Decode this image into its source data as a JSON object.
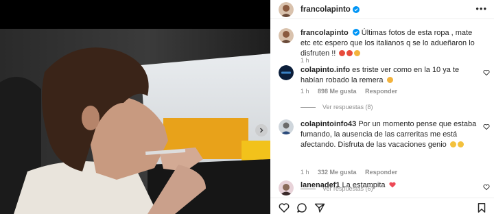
{
  "post": {
    "username": "francolapinto",
    "caption_user": "francolapinto",
    "caption_text": "Últimas fotos de esta ropa , mate etc etc espero que los italianos q se lo adueñaron lo disfruten !!",
    "caption_time": "1 h"
  },
  "comments": [
    {
      "user": "colapinto.info",
      "text": "es triste ver como en la 10 ya te habían robado la remera",
      "time": "1 h",
      "likes": "898 Me gusta",
      "reply": "Responder",
      "view_replies": "Ver respuestas (8)"
    },
    {
      "user": "colapintoinfo43",
      "text": "Por un momento pense que estaba fumando, la ausencia de las carreritas me está afectando. Disfruta de las vacaciones genio",
      "time": "1 h",
      "likes": "332 Me gusta",
      "reply": "Responder",
      "view_replies": "Ver respuestas (6)"
    },
    {
      "user": "lanenadef1",
      "text": "La estampita"
    }
  ],
  "icons": {
    "verified": "verified-badge-icon",
    "more": "more-options-icon",
    "like": "heart-icon",
    "comment": "comment-icon",
    "share": "share-icon",
    "save": "bookmark-icon",
    "next": "chevron-right-icon"
  },
  "colors": {
    "verified": "#0095f6",
    "text": "#262626",
    "meta": "#8e8e8e",
    "heart_emoji": "#ed4956"
  }
}
